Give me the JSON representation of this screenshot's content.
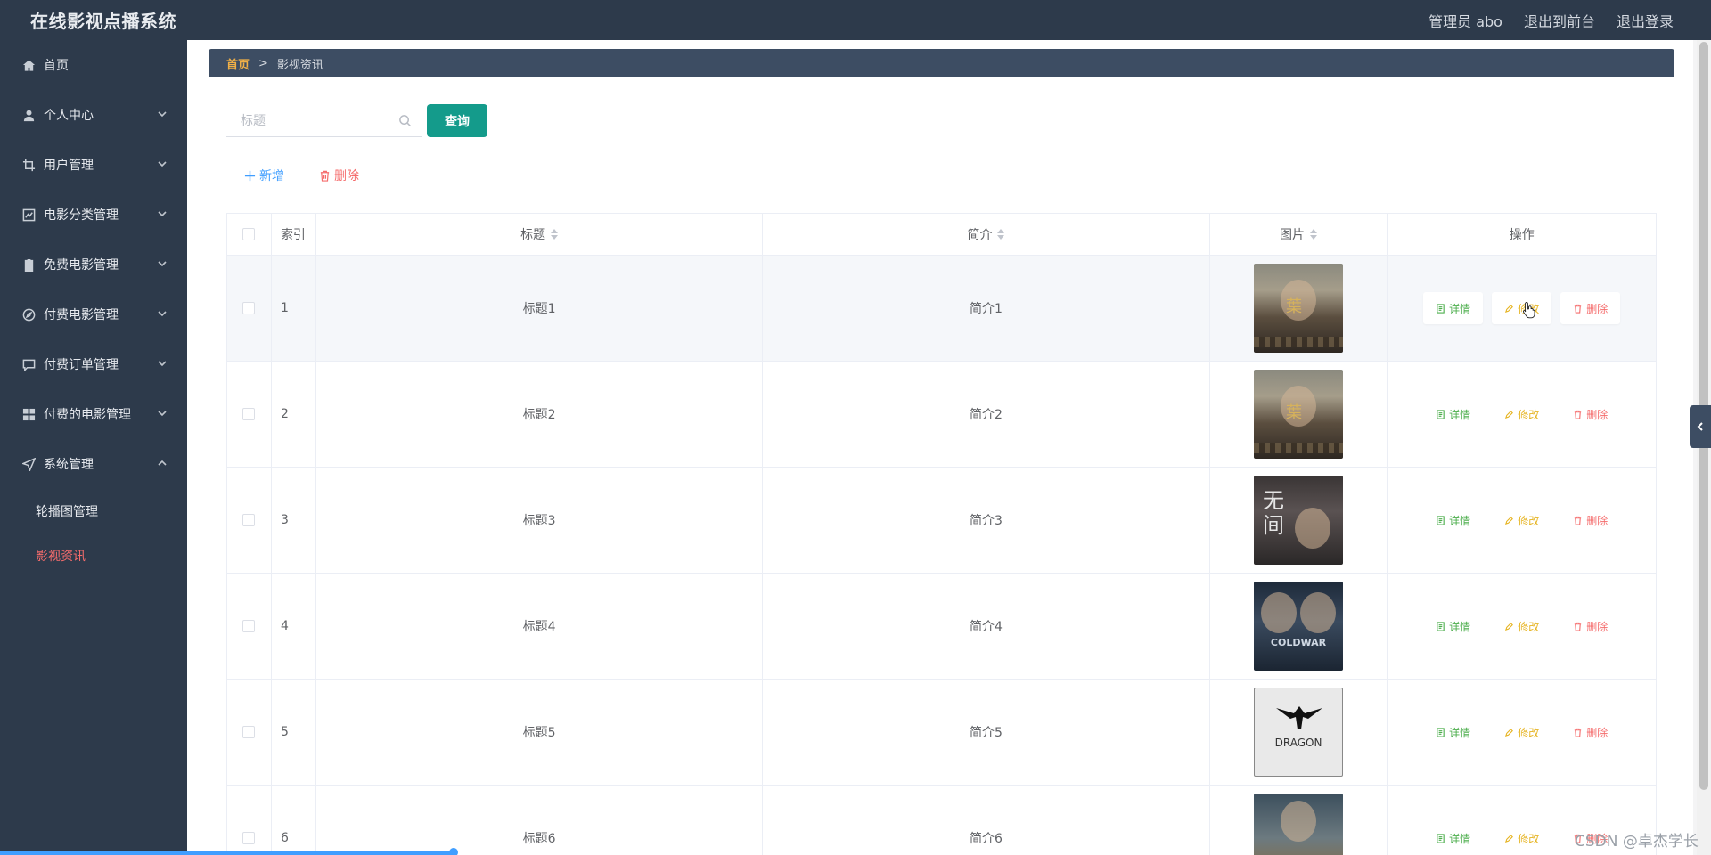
{
  "app": {
    "title": "在线影视点播系统"
  },
  "header": {
    "user_label": "管理员 abo",
    "front_link": "退出到前台",
    "logout_link": "退出登录"
  },
  "sidebar": {
    "items": [
      {
        "label": "首页",
        "icon": "home-icon"
      },
      {
        "label": "个人中心",
        "icon": "user-icon"
      },
      {
        "label": "用户管理",
        "icon": "crop-icon"
      },
      {
        "label": "电影分类管理",
        "icon": "chart-icon"
      },
      {
        "label": "免费电影管理",
        "icon": "clipboard-icon"
      },
      {
        "label": "付费电影管理",
        "icon": "compass-icon"
      },
      {
        "label": "付费订单管理",
        "icon": "chat-icon"
      },
      {
        "label": "付费的电影管理",
        "icon": "grid-icon"
      },
      {
        "label": "系统管理",
        "icon": "send-icon"
      }
    ],
    "sub_items": [
      {
        "label": "轮播图管理"
      },
      {
        "label": "影视资讯"
      }
    ]
  },
  "breadcrumb": {
    "home": "首页",
    "separator": ">",
    "current": "影视资讯"
  },
  "search": {
    "placeholder": "标题",
    "value": "",
    "button_label": "查询"
  },
  "actions": {
    "add_label": "新增",
    "delete_label": "删除"
  },
  "table": {
    "headers": {
      "index": "索引",
      "title": "标题",
      "intro": "简介",
      "image": "图片",
      "ops": "操作"
    },
    "rows": [
      {
        "index": "1",
        "title": "标题1",
        "intro": "简介1"
      },
      {
        "index": "2",
        "title": "标题2",
        "intro": "简介2"
      },
      {
        "index": "3",
        "title": "标题3",
        "intro": "简介3"
      },
      {
        "index": "4",
        "title": "标题4",
        "intro": "简介4"
      },
      {
        "index": "5",
        "title": "标题5",
        "intro": "简介5"
      },
      {
        "index": "6",
        "title": "标题6",
        "intro": "简介6"
      }
    ],
    "op_labels": {
      "detail": "详情",
      "edit": "修改",
      "remove": "删除"
    }
  },
  "watermark": "CSDN @卓杰学长",
  "colors": {
    "topbar": "#2d3a4b",
    "accent_teal": "#149b8b",
    "active_menu": "#f56c6c",
    "breadcrumb_home": "#f0b047"
  }
}
